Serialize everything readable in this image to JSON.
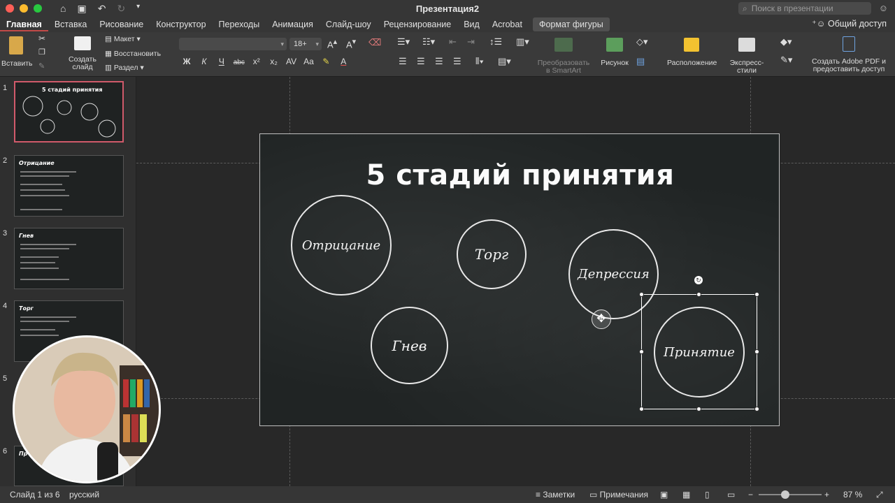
{
  "window": {
    "title": "Презентация2",
    "search_placeholder": "Поиск в презентации"
  },
  "tabs": [
    {
      "label": "Главная"
    },
    {
      "label": "Вставка"
    },
    {
      "label": "Рисование"
    },
    {
      "label": "Конструктор"
    },
    {
      "label": "Переходы"
    },
    {
      "label": "Анимация"
    },
    {
      "label": "Слайд-шоу"
    },
    {
      "label": "Рецензирование"
    },
    {
      "label": "Вид"
    },
    {
      "label": "Acrobat"
    },
    {
      "label": "Формат фигуры"
    }
  ],
  "share_label": "Общий доступ",
  "ribbon": {
    "paste": "Вставить",
    "new_slide_1": "Создать",
    "new_slide_2": "слайд",
    "layout": "Макет",
    "reset": "Восстановить",
    "section": "Раздел",
    "font_size": "18+",
    "convert_smartart_1": "Преобразовать",
    "convert_smartart_2": "в SmartArt",
    "picture": "Рисунок",
    "arrange": "Расположение",
    "quick_styles": "Экспресс-стили",
    "adobe_1": "Создать Adobe PDF и",
    "adobe_2": "предоставить доступ",
    "bold": "Ж",
    "italic": "К",
    "underline": "Ч",
    "strike": "abc"
  },
  "slides": [
    {
      "num": "1",
      "title": "5 стадий принятия"
    },
    {
      "num": "2",
      "title": "Отрицание"
    },
    {
      "num": "3",
      "title": "Гнев"
    },
    {
      "num": "4",
      "title": "Торг"
    },
    {
      "num": "5",
      "title": ""
    },
    {
      "num": "6",
      "title": "Пр"
    }
  ],
  "main_slide": {
    "title": "5 стадий принятия",
    "circles": {
      "denial": "Отрицание",
      "bargaining": "Торг",
      "depression": "Депрессия",
      "anger": "Гнев",
      "acceptance": "Принятие"
    }
  },
  "status": {
    "slide_counter": "Слайд 1 из 6",
    "language": "русский",
    "notes": "Заметки",
    "comments": "Примечания",
    "zoom": "87 %"
  },
  "colors": {
    "accent": "#c24a48",
    "slide_bg": "#202424",
    "chalk": "#f4f4f4"
  }
}
